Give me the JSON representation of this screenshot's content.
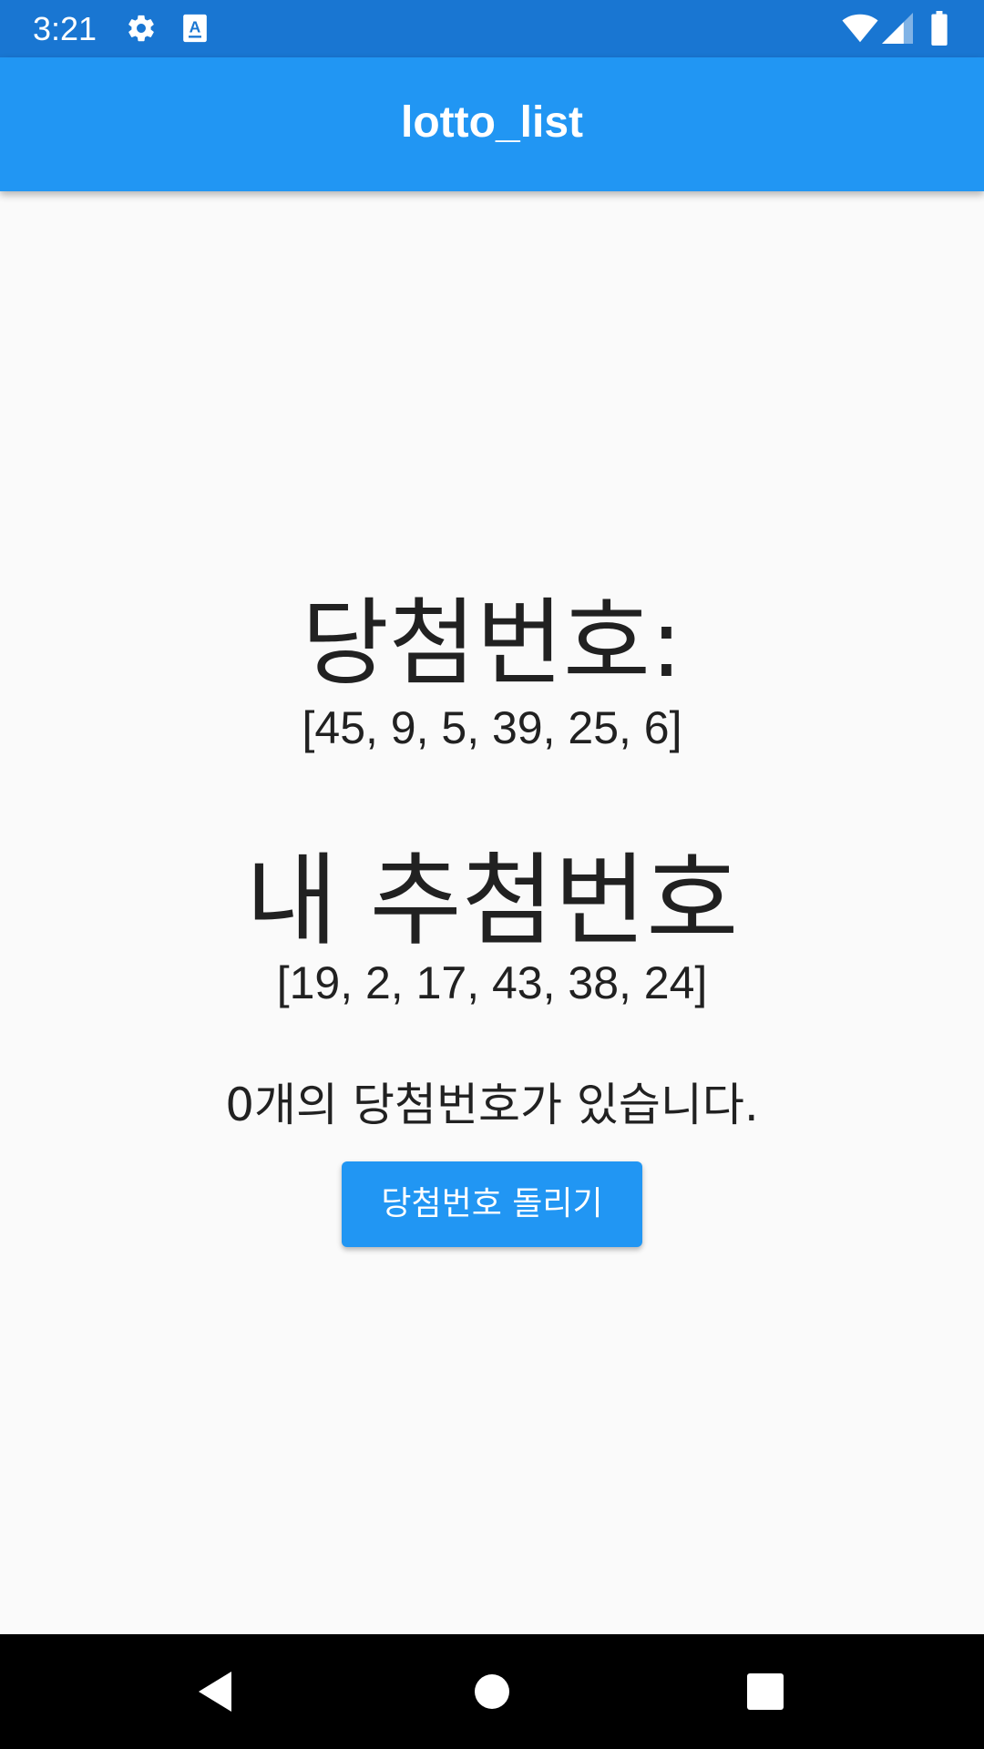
{
  "status_bar": {
    "time": "3:21",
    "icons": [
      "gear-icon",
      "a-notification-icon",
      "wifi-icon",
      "signal-icon",
      "battery-icon"
    ]
  },
  "app_bar": {
    "title": "lotto_list",
    "color": "#2196f3"
  },
  "main": {
    "winning_heading": "당첨번호:",
    "winning_numbers": "[45, 9, 5, 39, 25, 6]",
    "my_heading": "내 추첨번호",
    "my_numbers": "[19, 2, 17, 43, 38, 24]",
    "match_text": "0개의 당첨번호가 있습니다.",
    "draw_button_label": "당첨번호 돌리기"
  },
  "nav_bar": {
    "buttons": [
      "back-icon",
      "home-icon",
      "recents-icon"
    ]
  }
}
